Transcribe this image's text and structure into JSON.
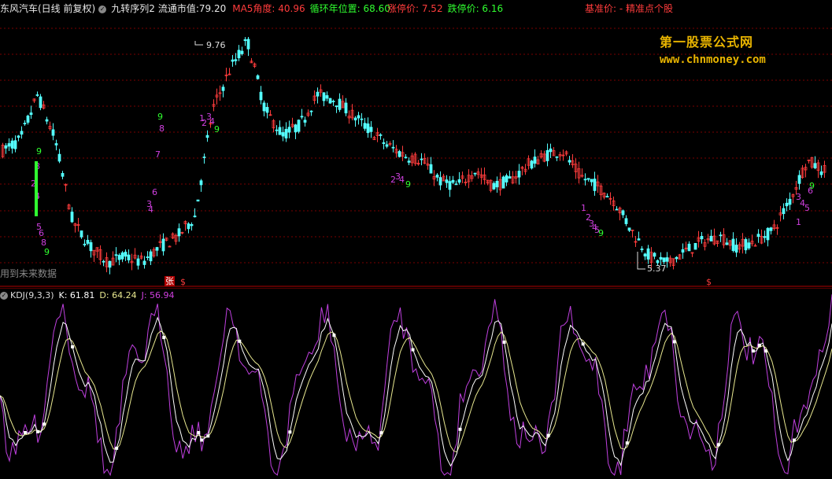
{
  "header": {
    "stock_title": "东风汽车(日线 前复权)",
    "indicator_name": "九转序列2",
    "market_cap_label": "流通市值:",
    "market_cap_value": "79.20",
    "ma5_angle": "MA5角度: 40.96",
    "cycle_position": "循环年位置: 68.60",
    "limit_up": "涨停价: 7.52",
    "limit_down": "跌停价: 6.16",
    "base_price": "基准价: - 精准点个股"
  },
  "watermark": {
    "line1": "第一股票公式网",
    "line2": "www.chnmoney.com"
  },
  "main_chart": {
    "high_label": "9.76",
    "low_label": "5.37",
    "future_data_note": "用到未来数据",
    "zhang_marker": "张",
    "dollar_marker": "$"
  },
  "kdj": {
    "title": "KDJ(9,3,3)",
    "k_label": "K: 61.81",
    "d_label": "D: 64.24",
    "j_label": "J: 56.94"
  },
  "colors": {
    "up_candle": "#ff3c3c",
    "down_candle": "#54ffff",
    "seq_magenta": "#d040e0",
    "seq_green": "#30ff30",
    "grid": "#7a0000",
    "j_line": "#c040e0",
    "k_line": "#ffffff",
    "d_line": "#e8e890"
  },
  "chart_data": {
    "type": "line",
    "title": "",
    "xlabel": "",
    "ylabel": "",
    "price_high": 9.76,
    "price_low": 5.37,
    "price_path": [
      7.6,
      7.8,
      8.7,
      7.8,
      6.2,
      5.7,
      5.4,
      5.5,
      5.4,
      5.7,
      5.9,
      6.3,
      8.4,
      9.2,
      9.76,
      8.4,
      7.9,
      8.1,
      8.7,
      8.6,
      8.3,
      8.0,
      7.7,
      7.5,
      7.4,
      7.0,
      6.9,
      7.2,
      6.9,
      7.0,
      7.3,
      7.5,
      7.6,
      7.1,
      6.9,
      6.6,
      6.0,
      5.5,
      5.37,
      5.6,
      5.8,
      5.9,
      5.7,
      5.8,
      6.0,
      6.6,
      7.4,
      7.2
    ],
    "seq_labels": [
      "9",
      "8",
      "2",
      "4",
      "5",
      "6",
      "8",
      "9",
      "3",
      "4",
      "6",
      "7",
      "8",
      "9",
      "1",
      "2",
      "3",
      "4",
      "9",
      "2",
      "3",
      "4",
      "9",
      "1",
      "2",
      "3",
      "4",
      "5",
      "9",
      "3",
      "4",
      "5",
      "6",
      "1",
      "9"
    ],
    "kdj_k_last": 61.81,
    "kdj_d_last": 64.24,
    "kdj_j_last": 56.94
  }
}
